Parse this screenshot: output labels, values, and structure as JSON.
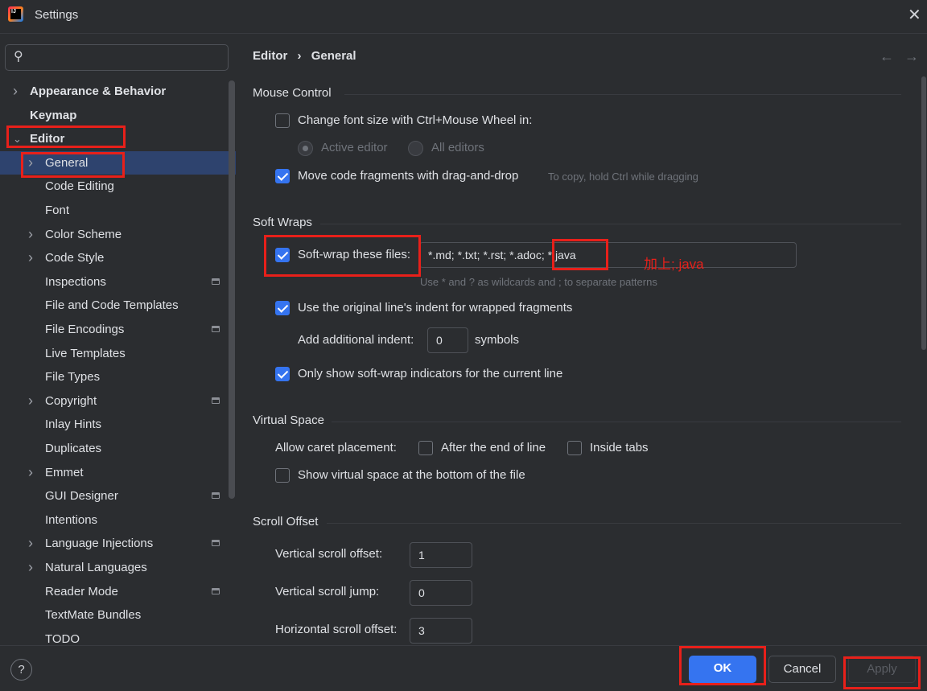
{
  "window": {
    "title": "Settings",
    "close_icon": "close-icon"
  },
  "search": {
    "placeholder": "",
    "icon": "search-icon"
  },
  "breadcrumb": {
    "parent": "Editor",
    "separator": "›",
    "current": "General"
  },
  "tree": [
    {
      "label": "Appearance & Behavior",
      "bold": true,
      "level": 0,
      "chevron": "right"
    },
    {
      "label": "Keymap",
      "bold": true,
      "level": 0
    },
    {
      "label": "Editor",
      "bold": true,
      "level": 0,
      "chevron": "down"
    },
    {
      "label": "General",
      "level": 1,
      "chevron": "right",
      "selected": true
    },
    {
      "label": "Code Editing",
      "level": 1
    },
    {
      "label": "Font",
      "level": 1
    },
    {
      "label": "Color Scheme",
      "level": 1,
      "chevron": "right"
    },
    {
      "label": "Code Style",
      "level": 1,
      "chevron": "right"
    },
    {
      "label": "Inspections",
      "level": 1,
      "settings_icon": true
    },
    {
      "label": "File and Code Templates",
      "level": 1
    },
    {
      "label": "File Encodings",
      "level": 1,
      "settings_icon": true
    },
    {
      "label": "Live Templates",
      "level": 1
    },
    {
      "label": "File Types",
      "level": 1
    },
    {
      "label": "Copyright",
      "level": 1,
      "chevron": "right",
      "settings_icon": true
    },
    {
      "label": "Inlay Hints",
      "level": 1
    },
    {
      "label": "Duplicates",
      "level": 1
    },
    {
      "label": "Emmet",
      "level": 1,
      "chevron": "right"
    },
    {
      "label": "GUI Designer",
      "level": 1,
      "settings_icon": true
    },
    {
      "label": "Intentions",
      "level": 1
    },
    {
      "label": "Language Injections",
      "level": 1,
      "chevron": "right",
      "settings_icon": true
    },
    {
      "label": "Natural Languages",
      "level": 1,
      "chevron": "right"
    },
    {
      "label": "Reader Mode",
      "level": 1,
      "settings_icon": true
    },
    {
      "label": "TextMate Bundles",
      "level": 1
    },
    {
      "label": "TODO",
      "level": 1
    }
  ],
  "mouse": {
    "title": "Mouse Control",
    "font_size": "Change font size with Ctrl+Mouse Wheel in:",
    "font_size_checked": false,
    "active_editor": "Active editor",
    "all_editors": "All editors",
    "drag": "Move code fragments with drag-and-drop",
    "drag_checked": true,
    "drag_hint": "To copy, hold Ctrl while dragging"
  },
  "soft": {
    "title": "Soft Wraps",
    "files_label": "Soft-wrap these files:",
    "files_checked": true,
    "files_value": "*.md; *.txt; *.rst; *.adoc; *.java",
    "files_hint": "Use * and ? as wildcards and ; to separate patterns",
    "annotation": "加上;.java",
    "indent": "Use the original line's indent for wrapped fragments",
    "indent_checked": true,
    "additional_label": "Add additional indent:",
    "additional_value": "0",
    "symbols": "symbols",
    "indicators": "Only show soft-wrap indicators for the current line",
    "indicators_checked": true
  },
  "virtual": {
    "title": "Virtual Space",
    "caret_label": "Allow caret placement:",
    "after_end": "After the end of line",
    "inside_tabs": "Inside tabs",
    "bottom": "Show virtual space at the bottom of the file"
  },
  "scroll": {
    "title": "Scroll Offset",
    "vertical_offset_label": "Vertical scroll offset:",
    "vertical_offset": "1",
    "vertical_jump_label": "Vertical scroll jump:",
    "vertical_jump": "0",
    "horizontal_offset_label": "Horizontal scroll offset:",
    "horizontal_offset": "3"
  },
  "footer": {
    "help": "?",
    "ok": "OK",
    "cancel": "Cancel",
    "apply": "Apply"
  },
  "colors": {
    "accent": "#3574f0",
    "selection": "#2e436e",
    "annotation": "#e8201a"
  }
}
